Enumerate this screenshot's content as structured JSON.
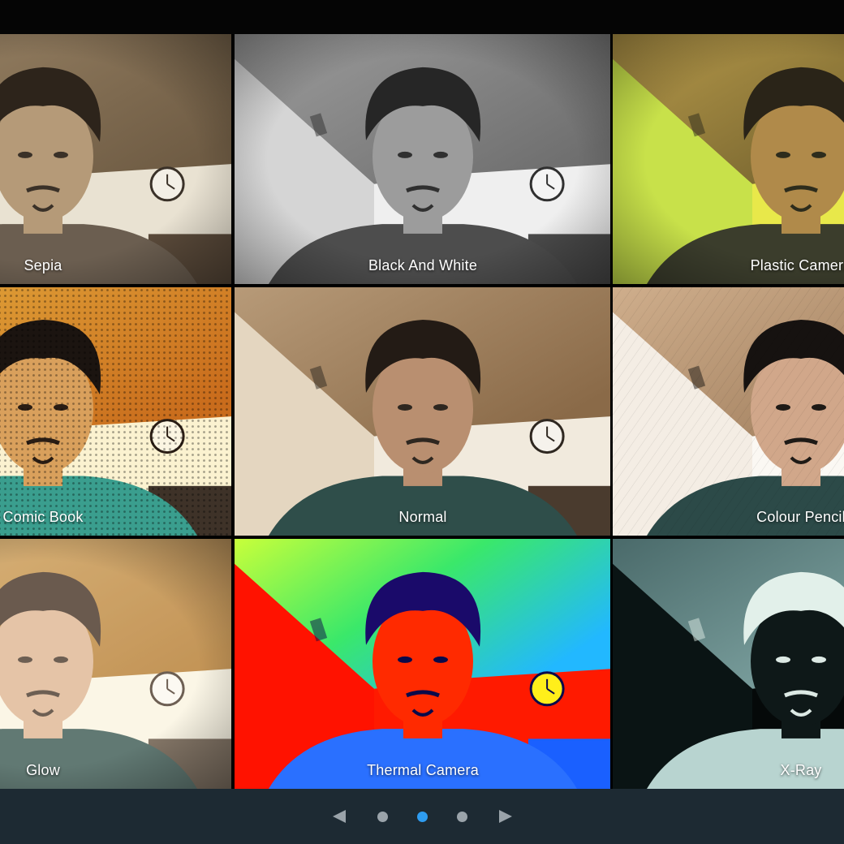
{
  "colors": {
    "background": "#000000",
    "bottom_bar": "#1d2a33",
    "dot_inactive": "#9aa3aa",
    "dot_active": "#2e9cf0",
    "arrow": "#9aa3aa",
    "label": "#ffffff"
  },
  "effects": [
    {
      "label": "Sepia",
      "style": "sepia"
    },
    {
      "label": "Black And White",
      "style": "bw"
    },
    {
      "label": "Plastic Camera",
      "style": "plastic"
    },
    {
      "label": "Comic Book",
      "style": "comic"
    },
    {
      "label": "Normal",
      "style": "normal"
    },
    {
      "label": "Colour Pencil",
      "style": "pencil"
    },
    {
      "label": "Glow",
      "style": "glow"
    },
    {
      "label": "Thermal Camera",
      "style": "thermal"
    },
    {
      "label": "X-Ray",
      "style": "xray"
    }
  ],
  "pager": {
    "page_count": 3,
    "current_page": 2,
    "prev_icon": "triangle-left-icon",
    "next_icon": "triangle-right-icon"
  }
}
